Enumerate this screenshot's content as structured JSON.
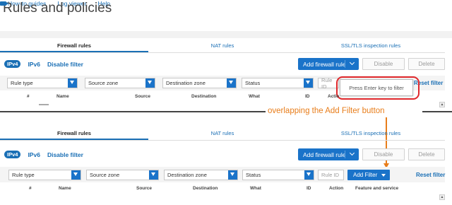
{
  "header": {
    "title": "Rules and policies",
    "links": [
      "How-to guides",
      "Log viewer",
      "Help"
    ]
  },
  "tabs": [
    "Firewall rules",
    "NAT rules",
    "SSL/TLS inspection rules"
  ],
  "toolbar": {
    "ipv4": "IPv4",
    "ipv6": "IPv6",
    "disable_filter": "Disable filter",
    "add_rule": "Add firewall rule",
    "disable": "Disable",
    "delete": "Delete"
  },
  "filters": {
    "rule_type": "Rule type",
    "source_zone": "Source zone",
    "destination_zone": "Destination zone",
    "status": "Status",
    "rule_id": "Rule ID",
    "add_filter": "Add Filter",
    "reset_filter": "Reset filter",
    "tooltip": "Press Enter key to filter"
  },
  "columns_top": [
    "#",
    "Name",
    "Source",
    "Destination",
    "What",
    "ID",
    "Actio"
  ],
  "columns_bottom": [
    "#",
    "Name",
    "Source",
    "Destination",
    "What",
    "ID",
    "Action",
    "Feature and service"
  ],
  "annotation": "overlapping the Add Filter button",
  "colors": {
    "accent": "#1a73c9",
    "highlight": "#e0282c",
    "annotation": "#e87d1a"
  }
}
